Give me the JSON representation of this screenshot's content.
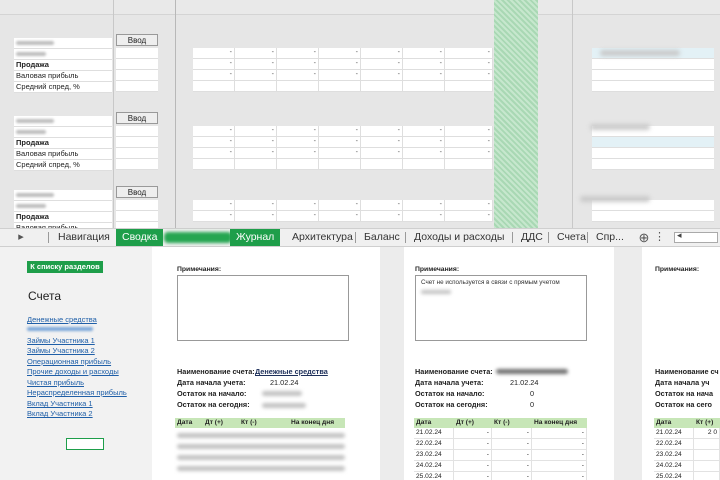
{
  "top": {
    "enter_label": "Ввод",
    "row_sales": "Продажа",
    "row_gross": "Валовая прибыль",
    "row_spread": "Средний спред, %",
    "dash": "-"
  },
  "tabs": {
    "nav_arrow": "▸",
    "items": [
      "Навигация",
      "Сводка",
      "Журнал",
      "Архитектура",
      "Баланс",
      "Доходы и расходы",
      "ДДС",
      "Счета",
      "Спр..."
    ],
    "more": "...",
    "add": "⊕",
    "options": "⋮",
    "scroll_left": "◂"
  },
  "left": {
    "back_button": "К списку разделов",
    "title": "Счета",
    "links": [
      "Денежные средства",
      "Займы Участника 1",
      "Займы Участника 2",
      "Операционная прибыль",
      "Прочие доходы и расходы",
      "Чистая прибыль",
      "Нераспределенная прибыль",
      "Вклад Участника 1",
      "Вклад Участника 2"
    ]
  },
  "panel1": {
    "notes_label": "Примечания:",
    "name_label": "Наименование счета:",
    "name_value": "Денежные средства",
    "start_label": "Дата начала учета:",
    "start_value": "21.02.24",
    "open_label": "Остаток на начало:",
    "today_label": "Остаток на сегодня:",
    "headers": [
      "Дата",
      "Дт (+)",
      "Кт (-)",
      "На конец дня"
    ]
  },
  "panel2": {
    "notes_label": "Примечания:",
    "notes_text": "Счет не используется в связи с прямым учетом",
    "name_label": "Наименование счета:",
    "start_label": "Дата начала учета:",
    "start_value": "21.02.24",
    "open_label": "Остаток на начало:",
    "open_value": "0",
    "today_label": "Остаток на сегодня:",
    "today_value": "0",
    "headers": [
      "Дата",
      "Дт (+)",
      "Кт (-)",
      "На конец дня"
    ],
    "rows": [
      [
        "21.02.24",
        "-",
        "-",
        "-"
      ],
      [
        "22.02.24",
        "-",
        "-",
        "-"
      ],
      [
        "23.02.24",
        "-",
        "-",
        "-"
      ],
      [
        "24.02.24",
        "-",
        "-",
        "-"
      ],
      [
        "25.02.24",
        "-",
        "-",
        "-"
      ]
    ]
  },
  "panel3": {
    "notes_label": "Примечания:",
    "name_label": "Наименование сч",
    "start_label": "Дата начала уч",
    "open_label": "Остаток на нача",
    "today_label": "Остаток на сего",
    "headers": [
      "Дата",
      "Кт (+)"
    ],
    "rows": [
      [
        "21.02.24",
        "2 0"
      ],
      [
        "22.02.24",
        ""
      ],
      [
        "23.02.24",
        ""
      ],
      [
        "24.02.24",
        ""
      ],
      [
        "25.02.24",
        ""
      ]
    ]
  }
}
